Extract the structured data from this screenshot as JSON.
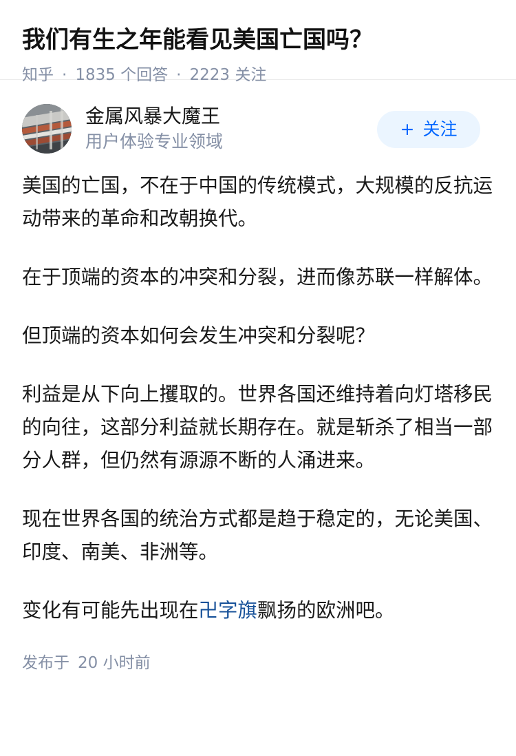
{
  "question": {
    "title": "我们有生之年能看见美国亡国吗？",
    "source": "知乎",
    "answers_count": "1835",
    "answers_label": "个回答",
    "followers_count": "2223",
    "followers_label": "关注",
    "separator": "·"
  },
  "author": {
    "name": "金属风暴大魔王",
    "bio": "用户体验专业领域",
    "follow_label": "关注",
    "follow_icon": "+"
  },
  "answer": {
    "paragraphs": [
      "美国的亡国，不在于中国的传统模式，大规模的反抗运动带来的革命和改朝换代。",
      "在于顶端的资本的冲突和分裂，进而像苏联一样解体。",
      "但顶端的资本如何会发生冲突和分裂呢？",
      "利益是从下向上攫取的。世界各国还维持着向灯塔移民的向往，这部分利益就长期存在。就是斩杀了相当一部分人群，但仍然有源源不断的人涌进来。",
      "现在世界各国的统治方式都是趋于稳定的，无论美国、印度、南美、非洲等。"
    ],
    "last_paragraph": {
      "before": "变化有可能先出现在",
      "link": "卍字旗",
      "after": "飘扬的欧洲吧。"
    },
    "posted_label": "发布于",
    "posted_time": "20 小时前"
  },
  "colors": {
    "link": "#175199",
    "meta": "#8590a6",
    "follow_bg": "#ebf5ff",
    "follow_text": "#0066ff"
  }
}
